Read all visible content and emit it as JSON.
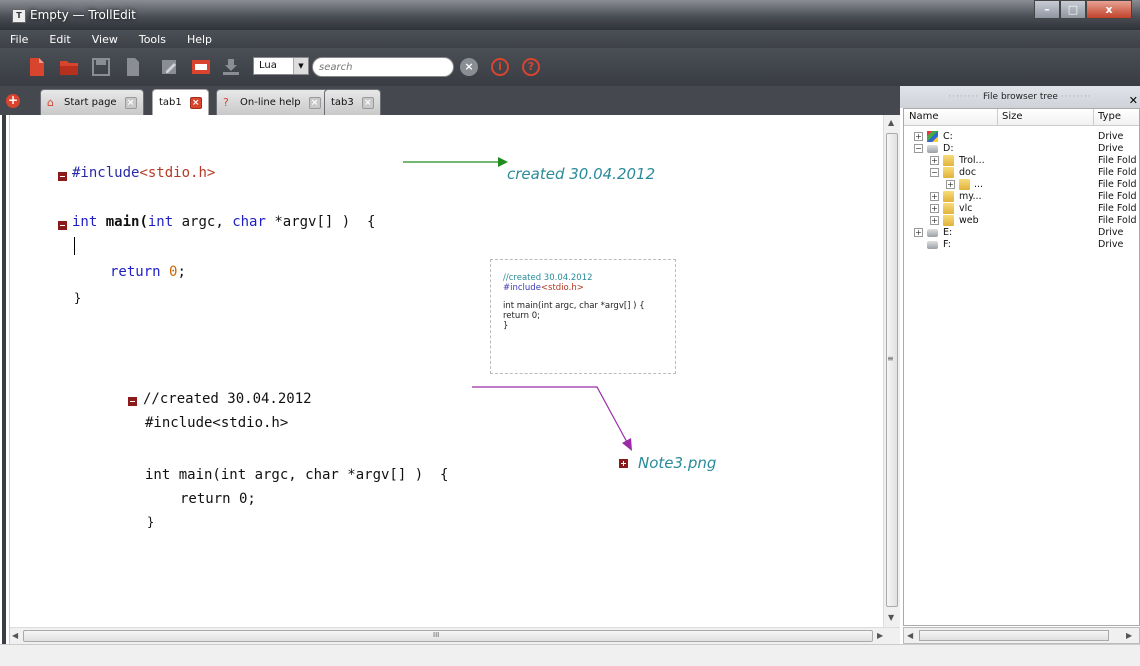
{
  "window": {
    "title": "Empty — TrollEdit",
    "app_icon": "T",
    "min_label": "–",
    "max_label": "□",
    "close_label": "x"
  },
  "menu": [
    "File",
    "Edit",
    "View",
    "Tools",
    "Help"
  ],
  "toolbar": {
    "language": "Lua",
    "search_placeholder": "search"
  },
  "tabs": [
    {
      "label": "Start page",
      "icon": "home-icon",
      "active": false
    },
    {
      "label": "tab1",
      "icon": "",
      "active": true
    },
    {
      "label": "On-line help",
      "icon": "help-icon",
      "active": false
    },
    {
      "label": "tab3",
      "icon": "",
      "active": false
    }
  ],
  "editor": {
    "block1": {
      "include_directive": "#include",
      "include_header": "<stdio.h>",
      "main_type": "int",
      "main_name": " main(",
      "main_argc_type": "int",
      "main_argc": " argc, ",
      "main_argv_type": "char",
      "main_argv": " *argv[]",
      "main_close": " )  {",
      "return_kw": "return",
      "return_val": "0",
      "return_end": ";",
      "close_brace": "}"
    },
    "note_created": "created 30.04.2012",
    "note_image": "Note3.png",
    "block2": {
      "comment": "//created 30.04.2012",
      "include": "#include<stdio.h>",
      "main": "int main(int argc, char *argv[] )  {",
      "return_stmt": "return 0;",
      "close_brace": "}"
    },
    "preview": {
      "comment": "//created 30.04.2012",
      "include_kw": "#include",
      "include_hdr": "<stdio.h>",
      "main": "int main(int argc, char *argv[] ) {",
      "return_stmt": "return 0;",
      "close_brace": "}"
    }
  },
  "file_browser": {
    "title": "File browser tree",
    "columns": [
      "Name",
      "Size",
      "Type"
    ],
    "rows": [
      {
        "name": "C:",
        "type": "Drive",
        "icon": "windows-drive-icon"
      },
      {
        "name": "D:",
        "type": "Drive",
        "icon": "drive-icon"
      },
      {
        "name": "Trol...",
        "type": "File Fold",
        "icon": "folder-icon"
      },
      {
        "name": "doc",
        "type": "File Fold",
        "icon": "folder-icon"
      },
      {
        "name": "...",
        "type": "File Fold",
        "icon": "folder-icon"
      },
      {
        "name": "my...",
        "type": "File Fold",
        "icon": "folder-icon"
      },
      {
        "name": "vlc",
        "type": "File Fold",
        "icon": "folder-icon"
      },
      {
        "name": "web",
        "type": "File Fold",
        "icon": "folder-icon"
      },
      {
        "name": "E:",
        "type": "Drive",
        "icon": "drive-icon"
      },
      {
        "name": "F:",
        "type": "Drive",
        "icon": "drive-icon"
      }
    ]
  },
  "scroll": {
    "grip": "≡",
    "hgrip": "III"
  },
  "colors": {
    "titlebar": "#3e4248",
    "fold_marker": "#8b1a1a",
    "note_text": "#2a8b9a",
    "green_arrow": "#1e8c1e",
    "purple_arrow": "#9b2aa8",
    "active_tab_close": "#d9442f"
  }
}
